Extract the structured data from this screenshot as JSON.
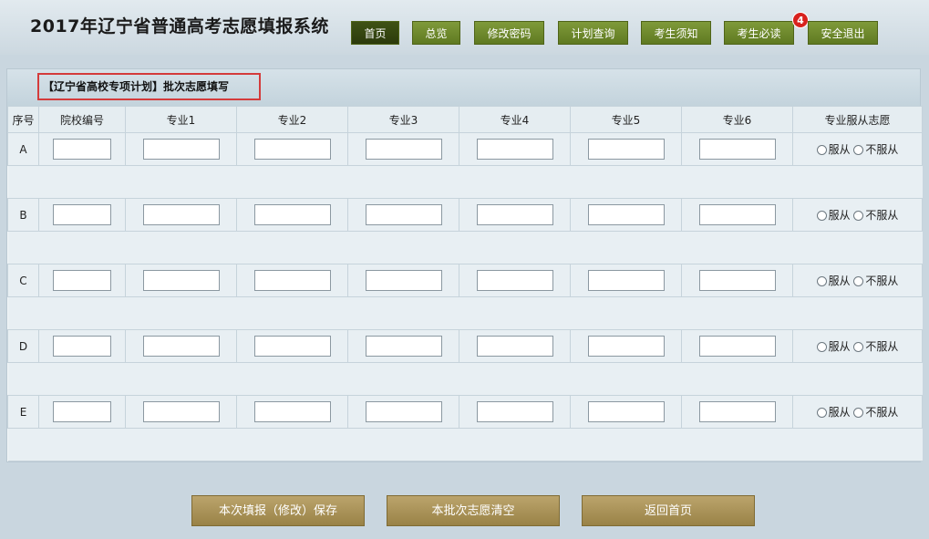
{
  "app_title": "2017年辽宁省普通高考志愿填报系统",
  "nav": [
    "首页",
    "总览",
    "修改密码",
    "计划查询",
    "考生须知",
    "考生必读",
    "安全退出"
  ],
  "nav_badge": "4",
  "panel_title": "【辽宁省高校专项计划】批次志愿填写",
  "columns": [
    "序号",
    "院校编号",
    "专业1",
    "专业2",
    "专业3",
    "专业4",
    "专业5",
    "专业6",
    "专业服从志愿"
  ],
  "rows": [
    "A",
    "B",
    "C",
    "D",
    "E"
  ],
  "radio": {
    "obey": "服从",
    "not_obey": "不服从"
  },
  "buttons": {
    "save": "本次填报（修改）保存",
    "clear": "本批次志愿清空",
    "home": "返回首页"
  },
  "colors": {
    "nav_green": "#6e8a2e",
    "nav_active": "#35470f",
    "badge_red": "#d8221e",
    "highlight_red": "#d43b3b",
    "action_gold": "#aa9358"
  }
}
